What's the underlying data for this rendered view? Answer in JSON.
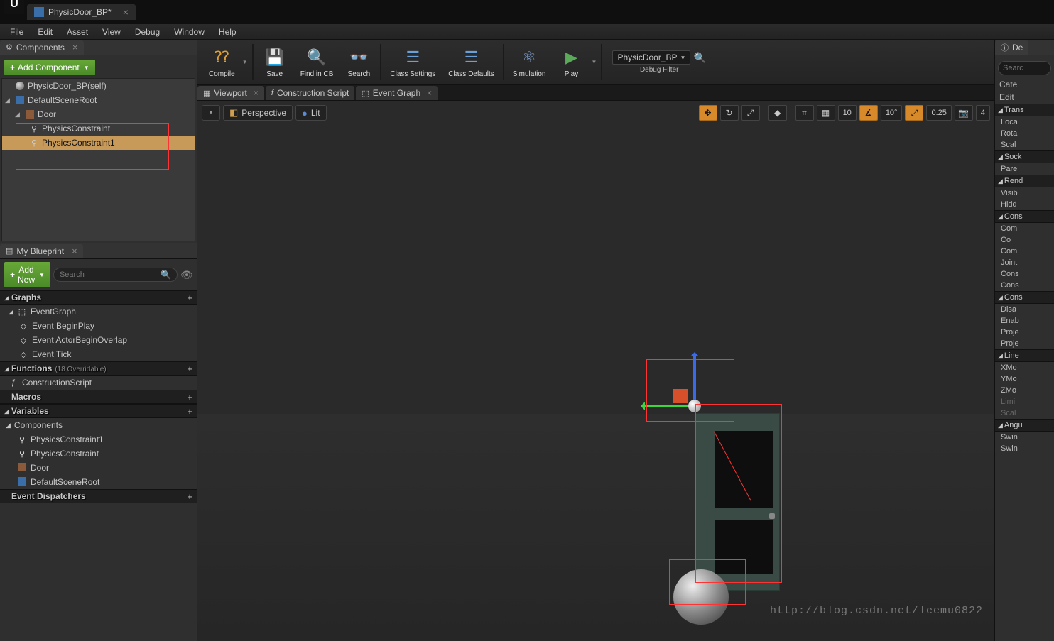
{
  "titlebar": {
    "doc_name": "PhysicDoor_BP*"
  },
  "menubar": [
    "File",
    "Edit",
    "Asset",
    "View",
    "Debug",
    "Window",
    "Help"
  ],
  "components_panel": {
    "tab_label": "Components",
    "add_button": "Add Component",
    "root_self": "PhysicDoor_BP(self)",
    "tree": [
      {
        "name": "DefaultSceneRoot",
        "icon": "scene"
      },
      {
        "name": "Door",
        "icon": "door"
      },
      {
        "name": "PhysicsConstraint",
        "icon": "constraint"
      },
      {
        "name": "PhysicsConstraint1",
        "icon": "constraint",
        "selected": true
      }
    ]
  },
  "mybp_panel": {
    "tab_label": "My Blueprint",
    "add_button": "Add New",
    "search_placeholder": "Search",
    "sections": {
      "graphs": {
        "title": "Graphs",
        "items": [
          "EventGraph",
          "Event BeginPlay",
          "Event ActorBeginOverlap",
          "Event Tick"
        ]
      },
      "functions": {
        "title": "Functions",
        "note": "(18 Overridable)",
        "items": [
          "ConstructionScript"
        ]
      },
      "macros": {
        "title": "Macros"
      },
      "variables": {
        "title": "Variables",
        "sub": "Components",
        "items": [
          "PhysicsConstraint1",
          "PhysicsConstraint",
          "Door",
          "DefaultSceneRoot"
        ]
      },
      "dispatchers": {
        "title": "Event Dispatchers"
      }
    }
  },
  "toolbar": {
    "compile": "Compile",
    "save": "Save",
    "find": "Find in CB",
    "search": "Search",
    "class_settings": "Class Settings",
    "class_defaults": "Class Defaults",
    "simulation": "Simulation",
    "play": "Play",
    "debug_filter_value": "PhysicDoor_BP",
    "debug_filter_label": "Debug Filter"
  },
  "ed_tabs": {
    "viewport": "Viewport",
    "cscript": "Construction Script",
    "egraph": "Event Graph"
  },
  "viewport": {
    "menu": "▾",
    "perspective": "Perspective",
    "lit": "Lit",
    "grid": "10",
    "angle": "10°",
    "scale": "0.25",
    "cam": "4"
  },
  "details": {
    "tab_label": "De",
    "search_placeholder": "Searc",
    "cat_label": "Cate",
    "edit_label": "Edit",
    "sections": [
      {
        "head": "Trans",
        "rows": [
          "Loca",
          "Rota",
          "Scal"
        ]
      },
      {
        "head": "Sock",
        "rows": [
          "Pare"
        ]
      },
      {
        "head": "Rend",
        "rows": [
          "Visib",
          "Hidd"
        ]
      },
      {
        "head": "Cons",
        "rows": [
          "Com",
          "Co",
          "Com",
          "Joint",
          "Cons",
          "Cons"
        ]
      },
      {
        "head": "Cons",
        "rows": [
          "Disa",
          "Enab",
          "Proje",
          "Proje"
        ]
      },
      {
        "head": "Line",
        "rows": [
          "XMo",
          "YMo",
          "ZMo"
        ],
        "dimrows": [
          "Limi",
          "Scal"
        ]
      },
      {
        "head": "Angu",
        "rows": [
          "Swin",
          "Swin"
        ]
      }
    ]
  },
  "watermark": "http://blog.csdn.net/leemu0822"
}
